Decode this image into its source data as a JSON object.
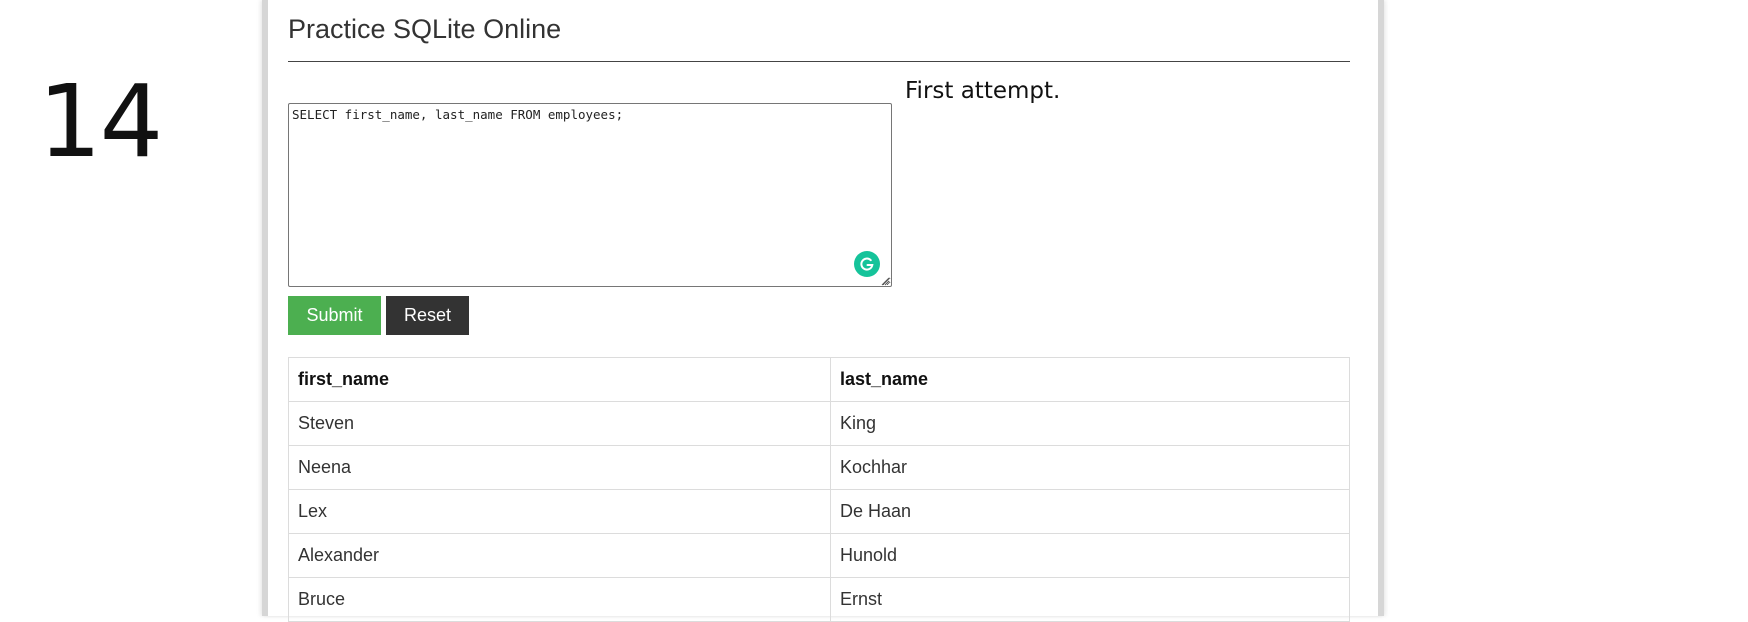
{
  "slide": {
    "number": "14"
  },
  "page": {
    "title": "Practice SQLite Online"
  },
  "editor": {
    "query": "SELECT first_name, last_name FROM employees;"
  },
  "note": {
    "text": "First attempt."
  },
  "buttons": {
    "submit_label": "Submit",
    "reset_label": "Reset"
  },
  "colors": {
    "submit": "#4caf50",
    "reset": "#333333",
    "grammarly": "#15c39a"
  },
  "icons": {
    "grammarly": "grammarly-icon",
    "resize": "resize-handle-icon"
  },
  "results": {
    "columns": [
      "first_name",
      "last_name"
    ],
    "rows": [
      [
        "Steven",
        "King"
      ],
      [
        "Neena",
        "Kochhar"
      ],
      [
        "Lex",
        "De Haan"
      ],
      [
        "Alexander",
        "Hunold"
      ],
      [
        "Bruce",
        "Ernst"
      ]
    ]
  }
}
